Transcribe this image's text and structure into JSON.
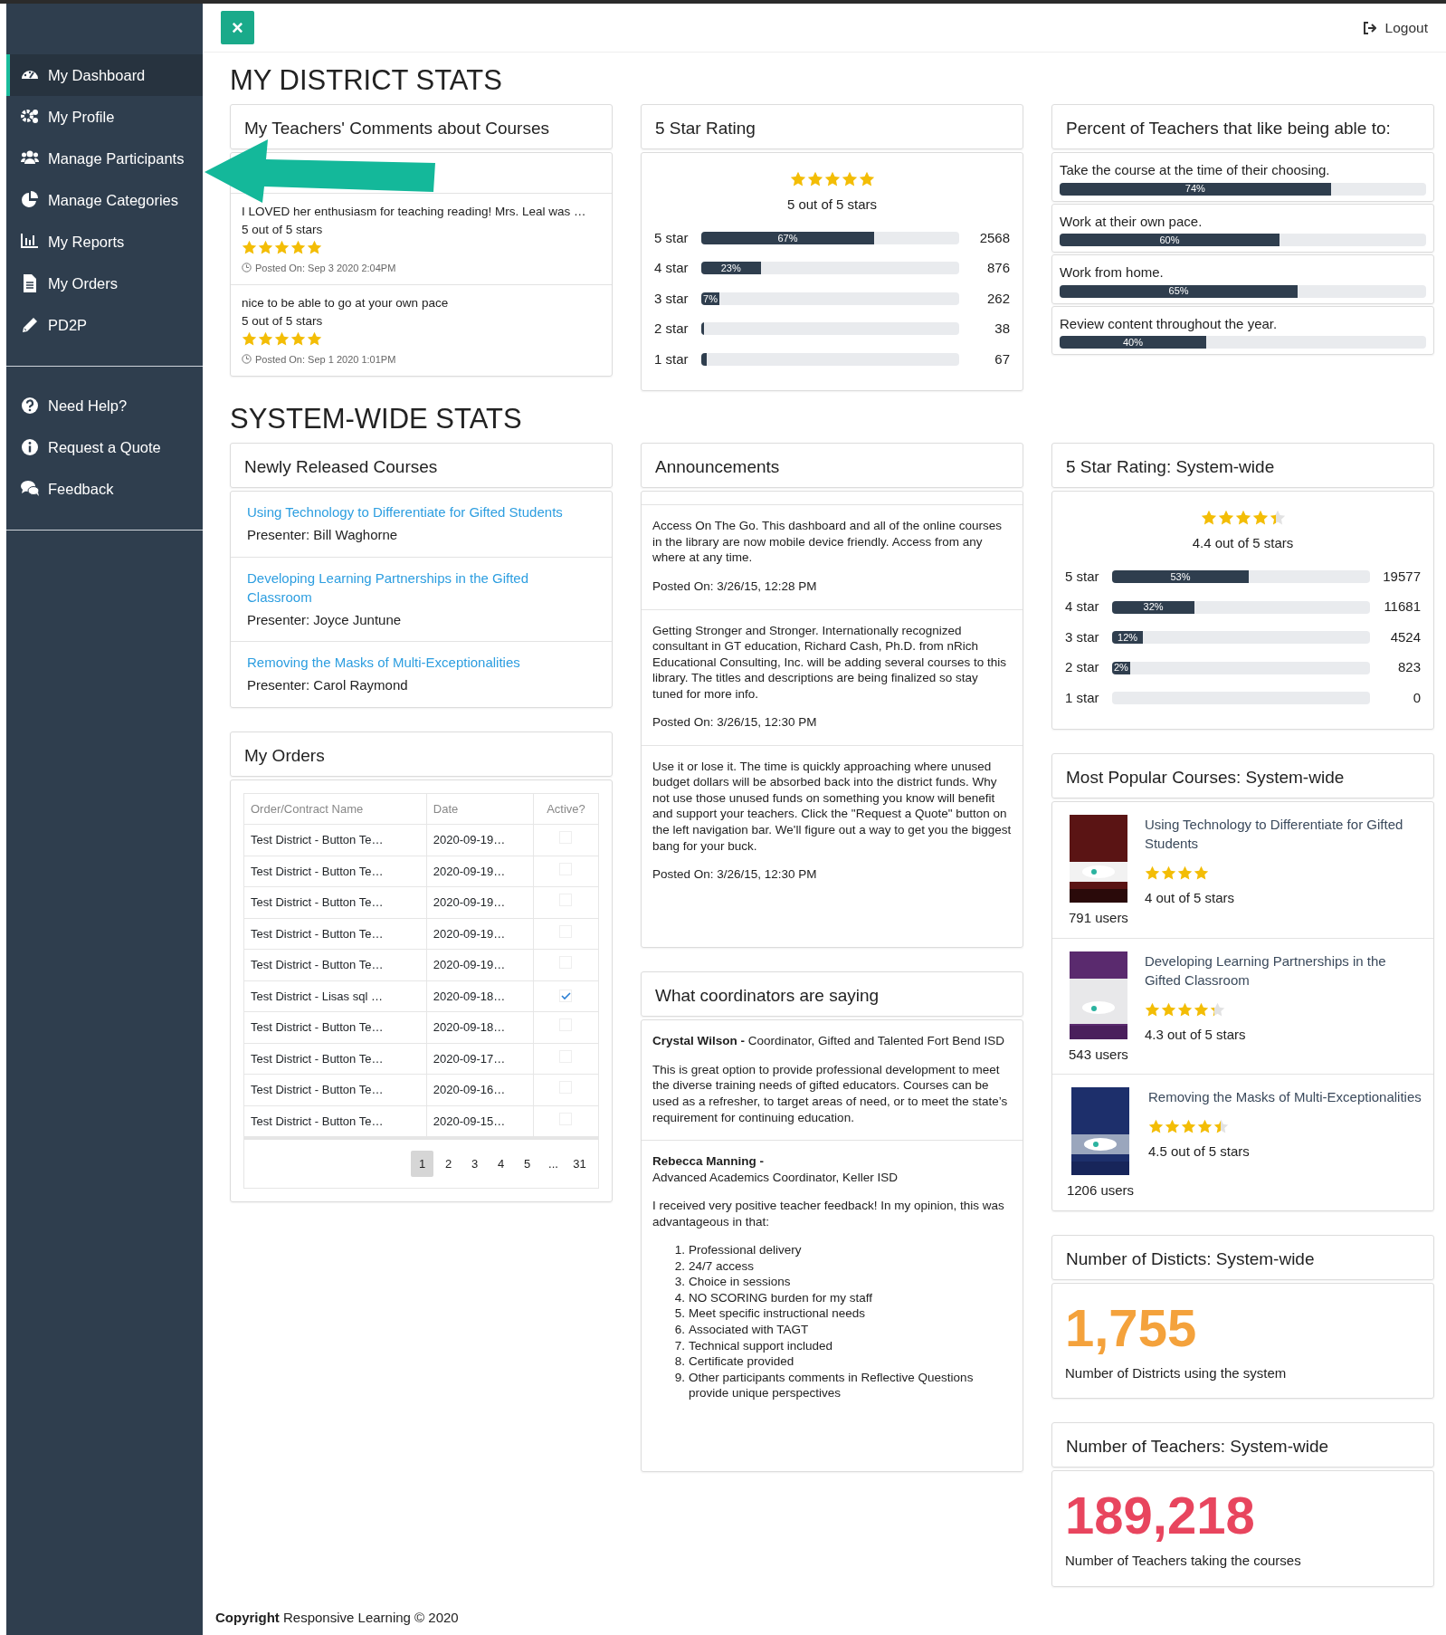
{
  "topbar": {
    "close": "×",
    "logout": "Logout"
  },
  "sidebar": {
    "main_items": [
      {
        "label": "My Dashboard",
        "selected": true
      },
      {
        "label": "My Profile",
        "selected": false
      },
      {
        "label": "Manage Participants",
        "selected": false
      },
      {
        "label": "Manage Categories",
        "selected": false
      },
      {
        "label": "My Reports",
        "selected": false
      },
      {
        "label": "My Orders",
        "selected": false
      },
      {
        "label": "PD2P",
        "selected": false
      }
    ],
    "help_items": [
      {
        "label": "Need Help?",
        "selected": false
      },
      {
        "label": "Request a Quote",
        "selected": false
      },
      {
        "label": "Feedback",
        "selected": false
      }
    ]
  },
  "district_title": "MY DISTRICT STATS",
  "comments": {
    "title": "My Teachers' Comments about Courses",
    "items": [
      {
        "text": "I LOVED her enthusiasm for teaching reading! Mrs. Leal was …",
        "rating_text": "5 out of 5 stars",
        "stars": 5,
        "posted": "Posted On: Sep 3 2020 2:04PM"
      },
      {
        "text": "nice to be able to go at your own pace",
        "rating_text": "5 out of 5 stars",
        "stars": 5,
        "posted": "Posted On: Sep 1 2020 1:01PM"
      }
    ]
  },
  "rating": {
    "title": "5 Star Rating",
    "stars": 5,
    "summary": "5 out of 5 stars",
    "rows": [
      {
        "label": "5 star",
        "level": 0.67,
        "bar_label": "67%",
        "count": "2568"
      },
      {
        "label": "4 star",
        "level": 0.23,
        "bar_label": "23%",
        "count": "876"
      },
      {
        "label": "3 star",
        "level": 0.07,
        "bar_label": "7%",
        "count": "262"
      },
      {
        "label": "2 star",
        "level": 0.01,
        "count": "38"
      },
      {
        "label": "1 star",
        "level": 0.02,
        "count": "67"
      }
    ]
  },
  "percent": {
    "title": "Percent of Teachers that like being able to:",
    "items": [
      {
        "label": "Take the course at the time of their choosing.",
        "level": 0.74,
        "bar_label": "74%"
      },
      {
        "label": "Work at their own pace.",
        "level": 0.6,
        "bar_label": "60%"
      },
      {
        "label": "Work from home.",
        "level": 0.65,
        "bar_label": "65%"
      },
      {
        "label": "Review content throughout the year.",
        "level": 0.4,
        "bar_label": "40%"
      }
    ]
  },
  "system_title": "SYSTEM-WIDE STATS",
  "new_courses": {
    "title": "Newly Released Courses",
    "items": [
      {
        "title": "Using Technology to Differentiate for Gifted Students",
        "presenter": "Presenter: Bill Waghorne"
      },
      {
        "title": "Developing Learning Partnerships in the Gifted Classroom",
        "presenter": "Presenter: Joyce Juntune"
      },
      {
        "title": "Removing the Masks of Multi-Exceptionalities",
        "presenter": "Presenter: Carol Raymond"
      }
    ]
  },
  "orders": {
    "title": "My Orders",
    "columns": [
      "Order/Contract Name",
      "Date",
      "Active?"
    ],
    "rows": [
      {
        "name": "Test District - Button Te…",
        "date": "2020-09-19…",
        "active": false
      },
      {
        "name": "Test District - Button Te…",
        "date": "2020-09-19…",
        "active": false
      },
      {
        "name": "Test District - Button Te…",
        "date": "2020-09-19…",
        "active": false
      },
      {
        "name": "Test District - Button Te…",
        "date": "2020-09-19…",
        "active": false
      },
      {
        "name": "Test District - Button Te…",
        "date": "2020-09-19…",
        "active": false
      },
      {
        "name": "Test District - Lisas sql …",
        "date": "2020-09-18…",
        "active": true
      },
      {
        "name": "Test District - Button Te…",
        "date": "2020-09-18…",
        "active": false
      },
      {
        "name": "Test District - Button Te…",
        "date": "2020-09-17…",
        "active": false
      },
      {
        "name": "Test District - Button Te…",
        "date": "2020-09-16…",
        "active": false
      },
      {
        "name": "Test District - Button Te…",
        "date": "2020-09-15…",
        "active": false
      }
    ],
    "pages": [
      {
        "label": "1",
        "selected": true
      },
      {
        "label": "2",
        "selected": false
      },
      {
        "label": "3",
        "selected": false
      },
      {
        "label": "4",
        "selected": false
      },
      {
        "label": "5",
        "selected": false
      },
      {
        "label": "...",
        "selected": false
      },
      {
        "label": "31",
        "selected": false
      }
    ]
  },
  "announcements": {
    "title": "Announcements",
    "items": [
      {
        "text": "Access On The Go. This dashboard and all of the online courses in the library are now mobile device friendly. Access from any where at any time.",
        "posted": "Posted On: 3/26/15, 12:28 PM"
      },
      {
        "text": "Getting Stronger and Stronger. Internationally recognized consultant in GT education, Richard Cash, Ph.D. from nRich Educational Consulting, Inc. will be adding several courses to this library. The titles and descriptions are being finalized so stay tuned for more info.",
        "posted": "Posted On: 3/26/15, 12:30 PM"
      },
      {
        "text": "Use it or lose it. The time is quickly approaching where unused budget dollars will be absorbed back into the district funds. Why not use those unused funds on something you know will benefit and support your teachers. Click the \"Request a Quote\" button on the left navigation bar. We'll figure out a way to get you the biggest bang for your buck.",
        "posted": "Posted On: 3/26/15, 12:30 PM"
      }
    ]
  },
  "coordinators": {
    "title": "What coordinators are saying",
    "items": [
      {
        "byline": "**Crystal Wilson -** Coordinator, Gifted and Talented Fort Bend ISD",
        "body": "This is great option to provide professional development to meet the diverse training needs of gifted educators. Courses can be used as a refresher, to target areas of need, or to meet the state’s requirement for continuing education."
      },
      {
        "byline": "**Rebecca Manning -**",
        "role": "Advanced Academics Coordinator, Keller ISD",
        "body": "I received very positive teacher feedback! In my opinion, this was advantageous in that:",
        "points": [
          {
            "marker": "1.",
            "text": "Professional delivery"
          },
          {
            "marker": "2.",
            "text": "24/7 access"
          },
          {
            "marker": "3.",
            "text": "Choice in sessions"
          },
          {
            "marker": "4.",
            "text": "NO SCORING burden for my staff"
          },
          {
            "marker": "5.",
            "text": "Meet specific instructional needs"
          },
          {
            "marker": "6.",
            "text": "Associated with TAGT"
          },
          {
            "marker": "7.",
            "text": "Technical support included"
          },
          {
            "marker": "8.",
            "text": "Certificate provided"
          },
          {
            "marker": "9.",
            "text": "Other participants comments in Reflective Questions provide unique perspectives"
          }
        ]
      }
    ]
  },
  "system_rating": {
    "title": "5 Star Rating: System-wide",
    "stars": 4.4,
    "summary": "4.4 out of 5 stars",
    "rows": [
      {
        "label": "5 star",
        "level": 0.53,
        "bar_label": "53%",
        "count": "19577"
      },
      {
        "label": "4 star",
        "level": 0.32,
        "bar_label": "32%",
        "count": "11681"
      },
      {
        "label": "3 star",
        "level": 0.12,
        "bar_label": "12%",
        "count": "4524"
      },
      {
        "label": "2 star",
        "level": 0.02,
        "bar_label": "2%",
        "count": "823"
      },
      {
        "label": "1 star",
        "level": 0,
        "count": "0"
      }
    ]
  },
  "popular": {
    "title": "Most Popular Courses: System-wide",
    "items": [
      {
        "title": "Using Technology to Differentiate for Gifted Students",
        "users": "791 users",
        "stars": 4,
        "rating_text": "4 out of 5 stars"
      },
      {
        "title": "Developing Learning Partnerships in the Gifted Classroom",
        "users": "543 users",
        "stars": 4.3,
        "rating_text": "4.3 out of 5 stars"
      },
      {
        "title": "Removing the Masks of Multi-Exceptionalities",
        "users": "1206 users",
        "stars": 4.5,
        "rating_text": "4.5 out of 5 stars"
      }
    ]
  },
  "stats": [
    {
      "title": "Number of Disticts: System-wide",
      "value": "1,755",
      "caption": "Number of Districts using the system",
      "color": "#f4a23c"
    },
    {
      "title": "Number of Teachers: System-wide",
      "value": "189,218",
      "caption": "Number of Teachers taking the courses",
      "color": "#e8455e"
    }
  ],
  "footer": "**Copyright** Responsive Learning © 2020"
}
